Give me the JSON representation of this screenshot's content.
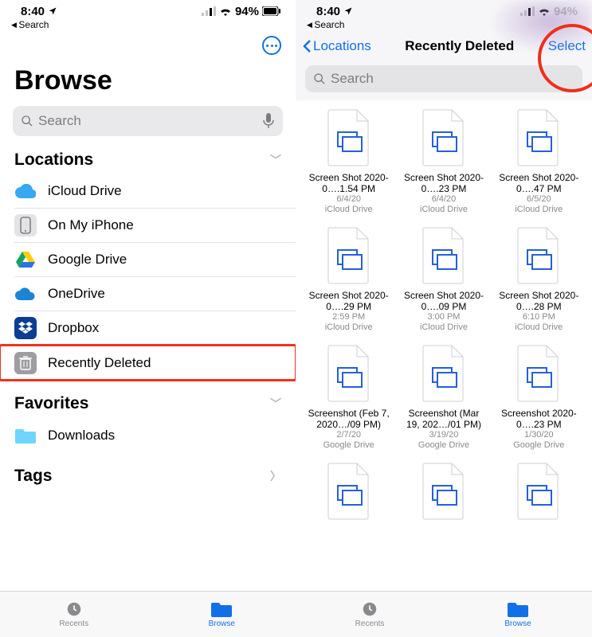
{
  "status": {
    "time": "8:40",
    "battery": "94%",
    "back_search": "Search"
  },
  "left": {
    "title": "Browse",
    "search_placeholder": "Search",
    "sections": {
      "locations": {
        "label": "Locations"
      },
      "favorites": {
        "label": "Favorites"
      },
      "tags": {
        "label": "Tags"
      }
    },
    "locations": [
      {
        "label": "iCloud Drive"
      },
      {
        "label": "On My iPhone"
      },
      {
        "label": "Google Drive"
      },
      {
        "label": "OneDrive"
      },
      {
        "label": "Dropbox"
      },
      {
        "label": "Recently Deleted"
      }
    ],
    "favorites": [
      {
        "label": "Downloads"
      }
    ]
  },
  "right": {
    "back_label": "Locations",
    "title": "Recently Deleted",
    "select_label": "Select",
    "search_placeholder": "Search",
    "files": [
      {
        "name": "Screen Shot 2020-0….1.54 PM",
        "line2": "6/4/20",
        "line3": "iCloud Drive"
      },
      {
        "name": "Screen Shot 2020-0….23 PM",
        "line2": "6/4/20",
        "line3": "iCloud Drive"
      },
      {
        "name": "Screen Shot 2020-0….47 PM",
        "line2": "6/5/20",
        "line3": "iCloud Drive"
      },
      {
        "name": "Screen Shot 2020-0….29 PM",
        "line2": "2:59 PM",
        "line3": "iCloud Drive"
      },
      {
        "name": "Screen Shot 2020-0….09 PM",
        "line2": "3:00 PM",
        "line3": "iCloud Drive"
      },
      {
        "name": "Screen Shot 2020-0….28 PM",
        "line2": "6:10 PM",
        "line3": "iCloud Drive"
      },
      {
        "name": "Screenshot (Feb 7, 2020…/09 PM)",
        "line2": "2/7/20",
        "line3": "Google Drive"
      },
      {
        "name": "Screenshot (Mar 19, 202…/01 PM)",
        "line2": "3/19/20",
        "line3": "Google Drive"
      },
      {
        "name": "Screenshot 2020-0….23 PM",
        "line2": "1/30/20",
        "line3": "Google Drive"
      },
      {
        "name": "",
        "line2": "",
        "line3": ""
      },
      {
        "name": "",
        "line2": "",
        "line3": ""
      },
      {
        "name": "",
        "line2": "",
        "line3": ""
      }
    ]
  },
  "tabbar": {
    "recents": "Recents",
    "browse": "Browse"
  }
}
